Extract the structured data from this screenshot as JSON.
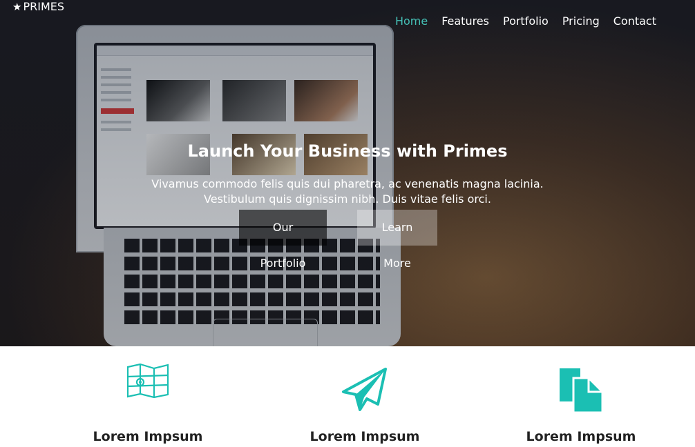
{
  "brand": {
    "name": "PRIMES",
    "icon": "star-icon"
  },
  "nav": {
    "items": [
      {
        "label": "Home",
        "active": true
      },
      {
        "label": "Features",
        "active": false
      },
      {
        "label": "Portfolio",
        "active": false
      },
      {
        "label": "Pricing",
        "active": false
      },
      {
        "label": "Contact",
        "active": false
      }
    ]
  },
  "hero": {
    "title": "Launch Your Business with Primes",
    "subtitle_line1": "Vivamus commodo felis quis dui pharetra, ac venenatis magna lacinia.",
    "subtitle_line2": "Vestibulum quis dignissim nibh. Duis vitae felis orci.",
    "primary_button": "Our Portfolio",
    "secondary_button": "Learn More"
  },
  "features": [
    {
      "title": "Lorem Impsum",
      "icon": "map-icon"
    },
    {
      "title": "Lorem Impsum",
      "icon": "paper-plane-icon"
    },
    {
      "title": "Lorem Impsum",
      "icon": "documents-icon"
    }
  ],
  "colors": {
    "accent": "#45c1b6",
    "accent_icon": "#1bbfb3"
  }
}
